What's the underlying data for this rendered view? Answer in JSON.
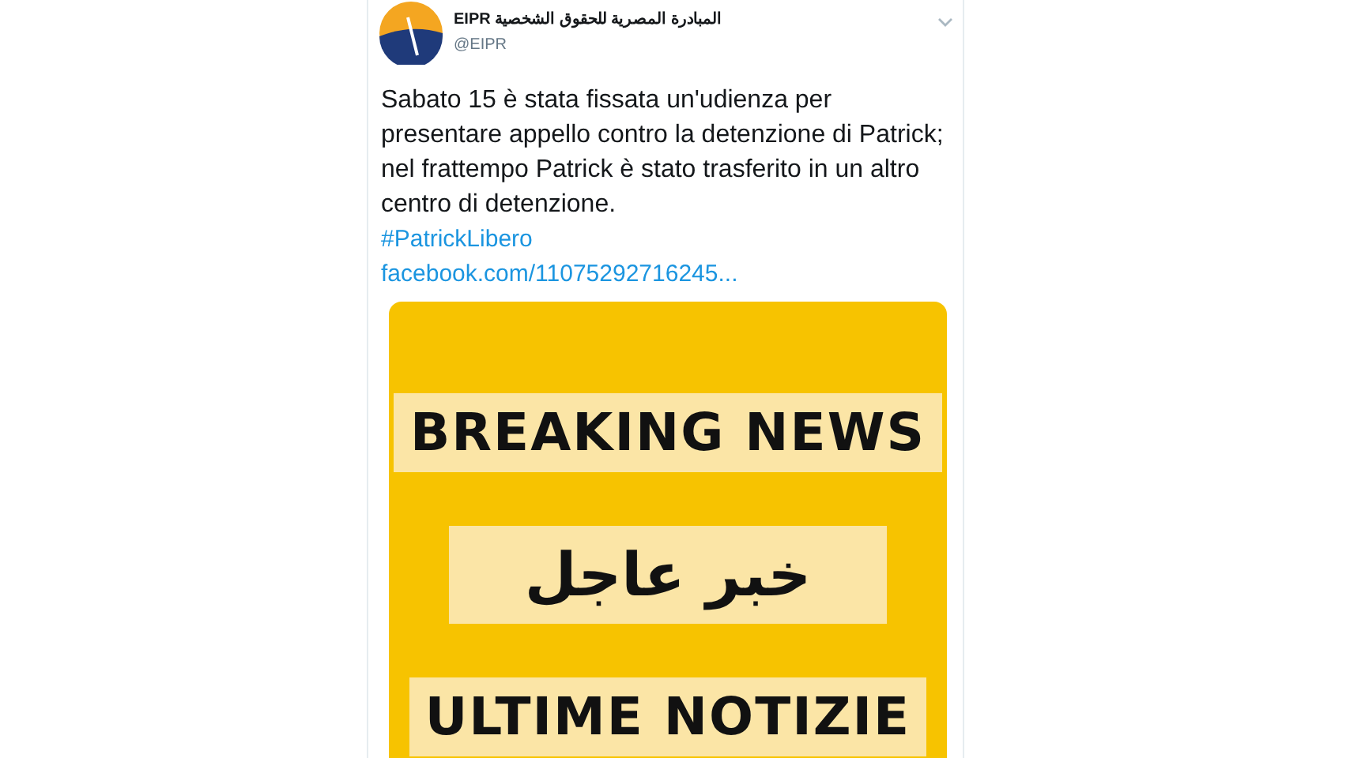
{
  "tweet": {
    "author_name": "EIPR المبادرة المصرية للحقوق الشخصية",
    "handle": "@EIPR",
    "text": "Sabato 15 è stata fissata un'udienza per presentare appello contro la detenzione di Patrick; nel frattempo Patrick è stato trasferito in un altro centro di detenzione.",
    "hashtag": "#PatrickLibero",
    "link": "facebook.com/11075292716245...",
    "media": {
      "lines": [
        "BREAKING NEWS",
        "خبر عاجل",
        "ULTIME NOTIZIE"
      ]
    }
  }
}
